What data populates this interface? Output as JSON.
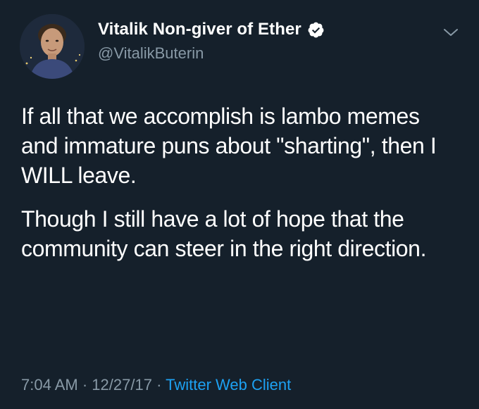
{
  "author": {
    "display_name": "Vitalik Non-giver of Ether",
    "handle": "@VitalikButerin",
    "verified": true,
    "avatar_icon": "user-avatar"
  },
  "tweet": {
    "paragraphs": [
      "If all that we accomplish is lambo memes and immature puns about \"sharting\", then I WILL leave.",
      "Though I still have a lot of hope that the community can steer in the right direction."
    ],
    "time": "7:04 AM",
    "date": "12/27/17",
    "separator": "·",
    "source": "Twitter Web Client"
  },
  "menu": {
    "icon": "chevron-down-icon"
  },
  "colors": {
    "background": "#15202b",
    "text": "#ffffff",
    "secondary": "#8899a6",
    "link": "#1da1f2"
  }
}
